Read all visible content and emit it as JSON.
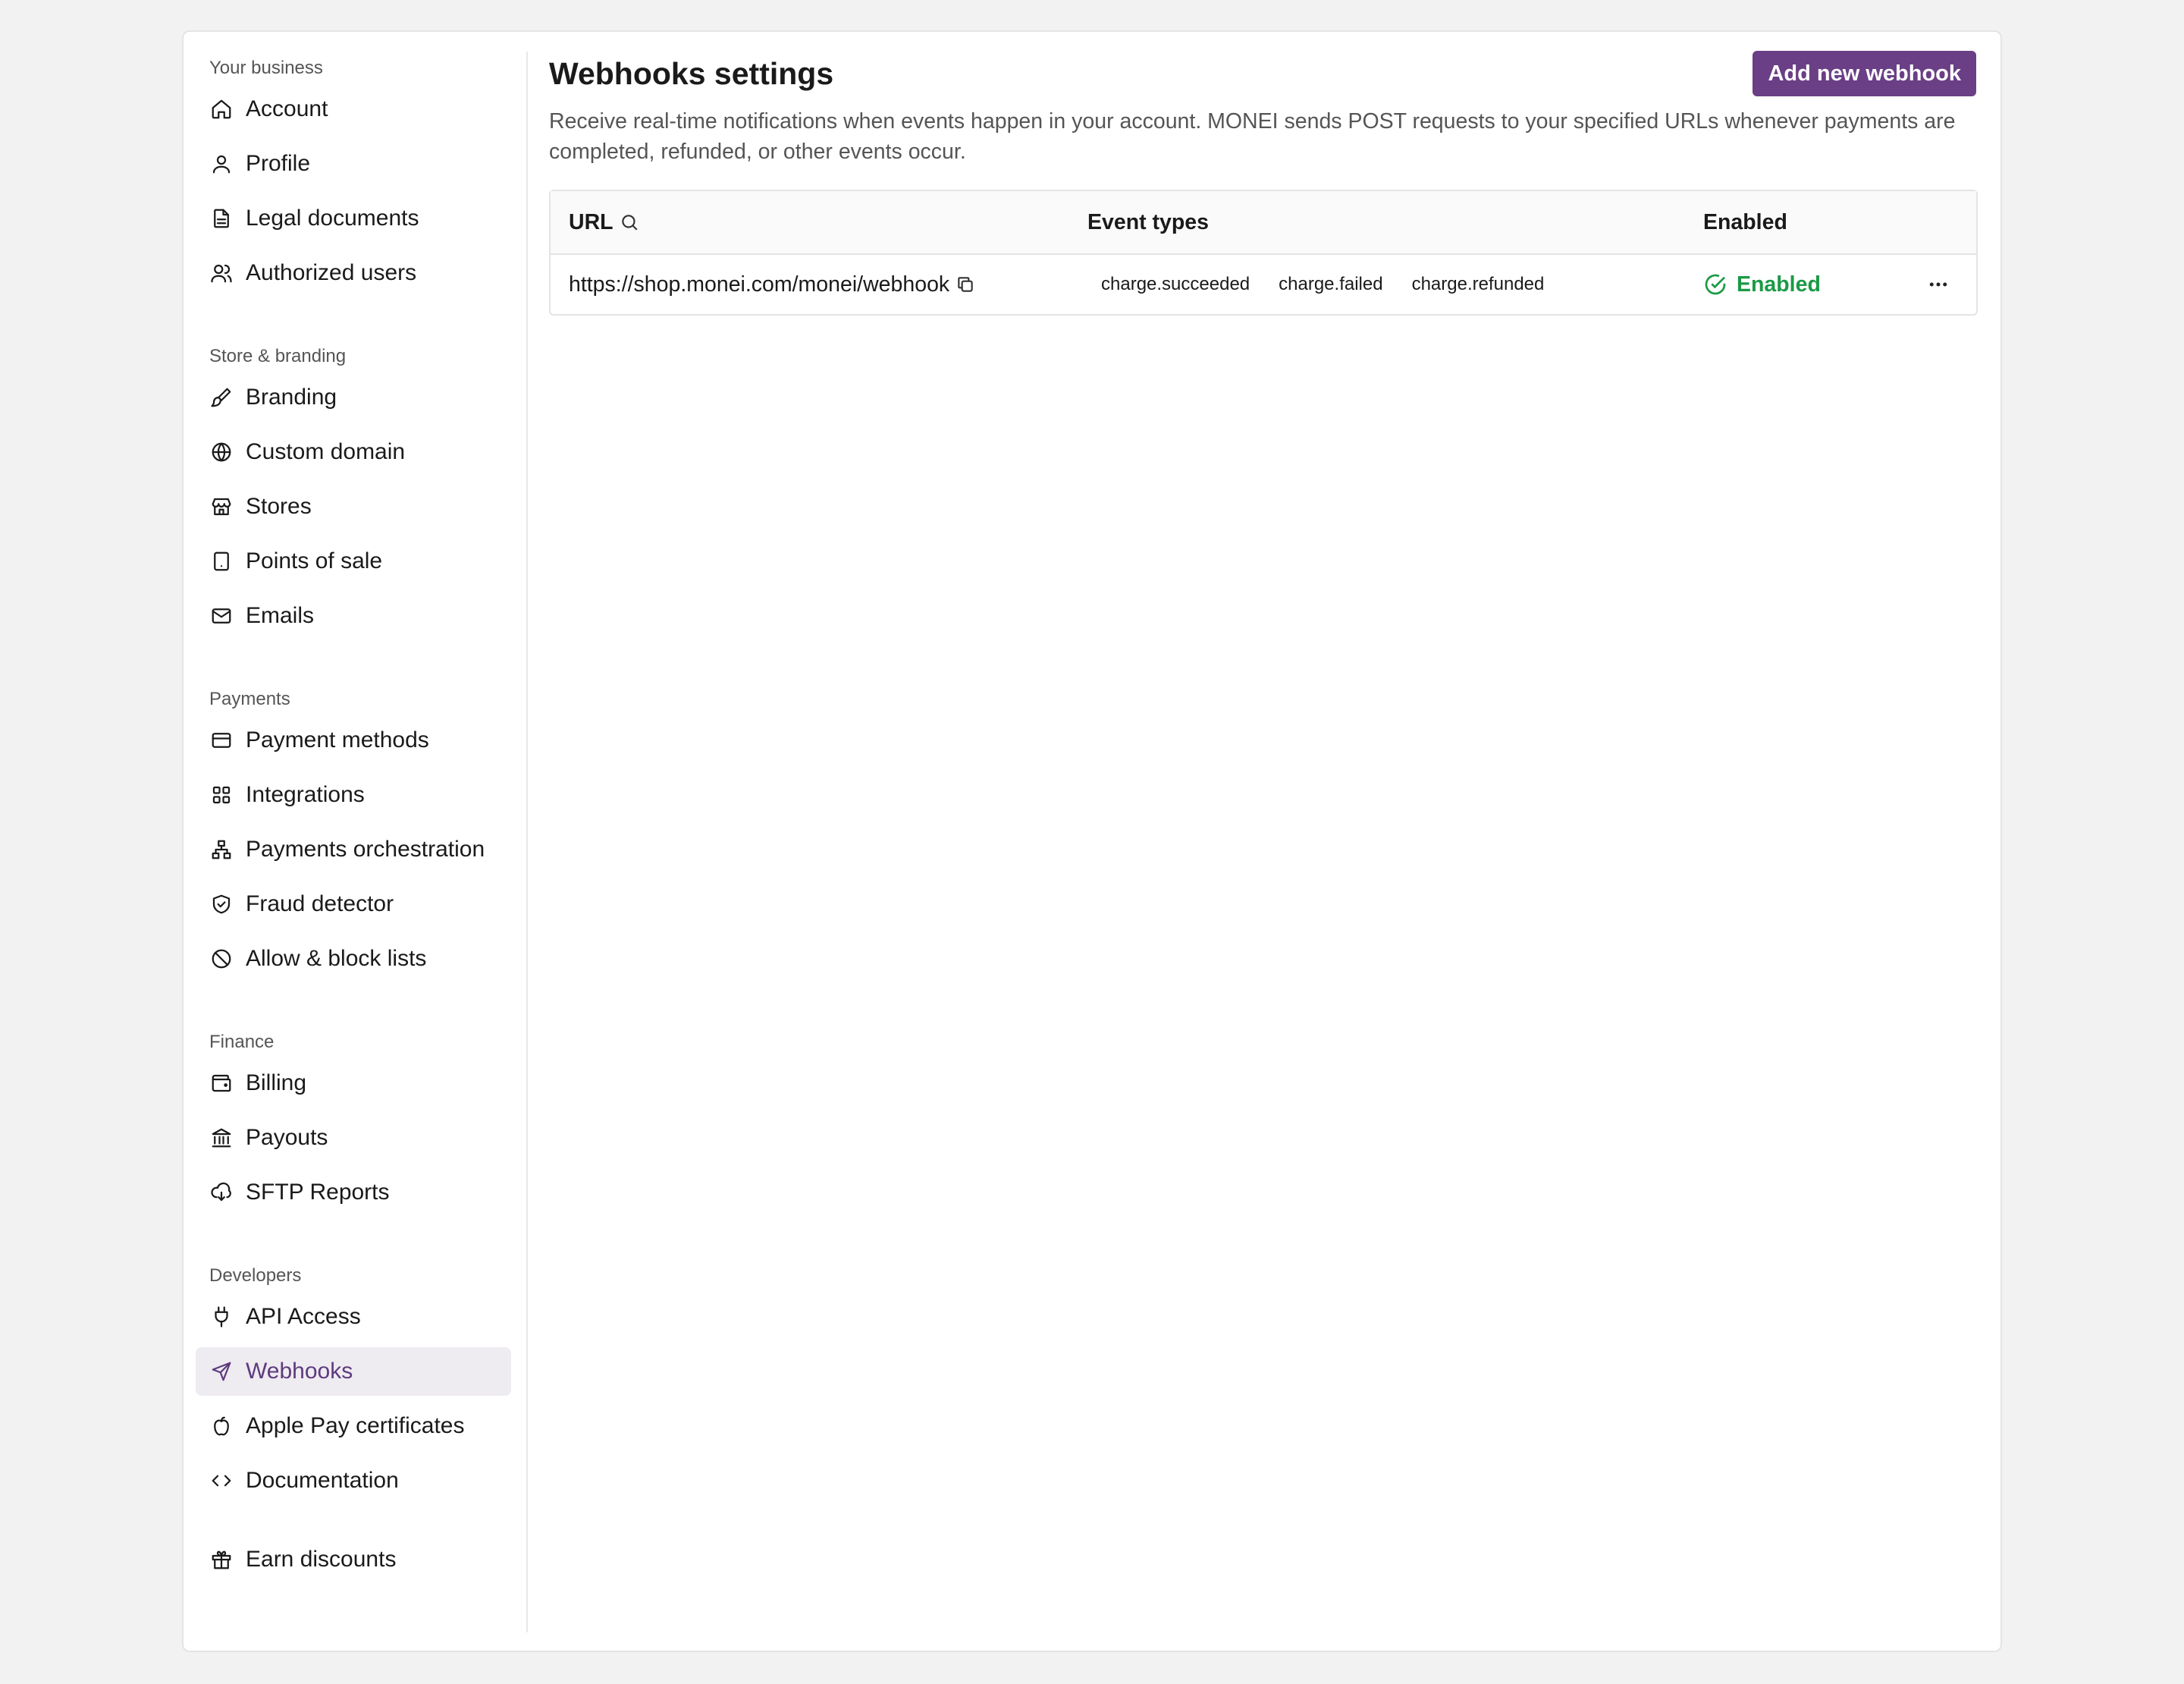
{
  "sidebar": {
    "groups": [
      {
        "title": "Your business",
        "items": [
          {
            "label": "Account",
            "icon": "home-icon"
          },
          {
            "label": "Profile",
            "icon": "user-icon"
          },
          {
            "label": "Legal documents",
            "icon": "document-icon"
          },
          {
            "label": "Authorized users",
            "icon": "users-icon"
          }
        ]
      },
      {
        "title": "Store & branding",
        "items": [
          {
            "label": "Branding",
            "icon": "paintbrush-icon"
          },
          {
            "label": "Custom domain",
            "icon": "globe-icon"
          },
          {
            "label": "Stores",
            "icon": "store-icon"
          },
          {
            "label": "Points of sale",
            "icon": "tablet-icon"
          },
          {
            "label": "Emails",
            "icon": "mail-icon"
          }
        ]
      },
      {
        "title": "Payments",
        "items": [
          {
            "label": "Payment methods",
            "icon": "credit-card-icon"
          },
          {
            "label": "Integrations",
            "icon": "grid-icon"
          },
          {
            "label": "Payments orchestration",
            "icon": "network-icon"
          },
          {
            "label": "Fraud detector",
            "icon": "shield-check-icon"
          },
          {
            "label": "Allow & block lists",
            "icon": "ban-icon"
          }
        ]
      },
      {
        "title": "Finance",
        "items": [
          {
            "label": "Billing",
            "icon": "wallet-icon"
          },
          {
            "label": "Payouts",
            "icon": "bank-icon"
          },
          {
            "label": "SFTP Reports",
            "icon": "cloud-download-icon"
          }
        ]
      },
      {
        "title": "Developers",
        "items": [
          {
            "label": "API Access",
            "icon": "plug-icon"
          },
          {
            "label": "Webhooks",
            "icon": "send-icon",
            "active": true
          },
          {
            "label": "Apple Pay certificates",
            "icon": "apple-icon"
          },
          {
            "label": "Documentation",
            "icon": "code-icon"
          }
        ]
      }
    ],
    "footer_item": {
      "label": "Earn discounts",
      "icon": "gift-icon"
    }
  },
  "main": {
    "title": "Webhooks settings",
    "add_button": "Add new webhook",
    "description": "Receive real-time notifications when events happen in your account. MONEI sends POST requests to your specified URLs whenever payments are completed, refunded, or other events occur.",
    "table": {
      "columns": {
        "url": "URL",
        "events": "Event types",
        "enabled": "Enabled"
      },
      "rows": [
        {
          "url": "https://shop.monei.com/monei/webhook",
          "events": [
            "charge.succeeded",
            "charge.failed",
            "charge.refunded"
          ],
          "status": "Enabled"
        }
      ]
    }
  },
  "colors": {
    "accent": "#6a3f86",
    "active_bg": "#eeebf1",
    "success": "#1a9a45"
  }
}
